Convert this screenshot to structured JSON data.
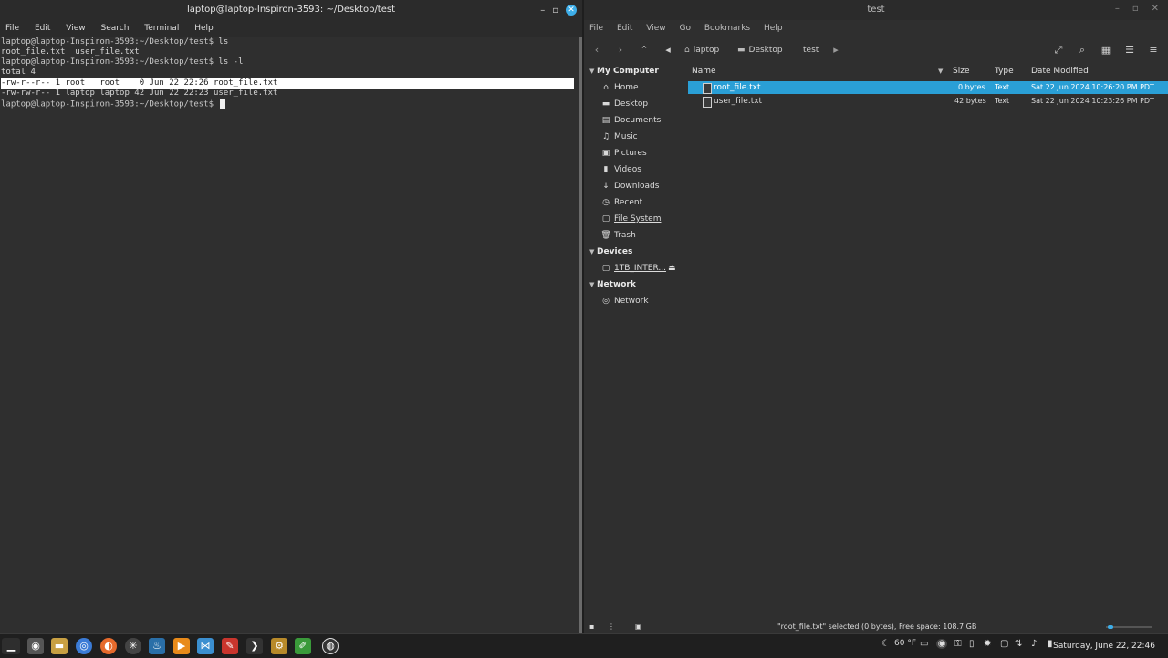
{
  "terminal": {
    "title": "laptop@laptop-Inspiron-3593: ~/Desktop/test",
    "menu": [
      "File",
      "Edit",
      "View",
      "Search",
      "Terminal",
      "Help"
    ],
    "lines": [
      {
        "prompt": "laptop@laptop-Inspiron-3593:~/Desktop/test$",
        "text": " ls"
      },
      {
        "prompt": "",
        "text": "root_file.txt  user_file.txt"
      },
      {
        "prompt": "laptop@laptop-Inspiron-3593:~/Desktop/test$",
        "text": " ls -l"
      },
      {
        "prompt": "",
        "text": "total 4"
      },
      {
        "prompt": "",
        "text": "-rw-r--r-- 1 root   root    0 Jun 22 22:26 root_file.txt"
      },
      {
        "prompt": "",
        "text": "-rw-rw-r-- 1 laptop laptop 42 Jun 22 22:23 user_file.txt"
      },
      {
        "prompt": "laptop@laptop-Inspiron-3593:~/Desktop/test$",
        "text": " "
      }
    ]
  },
  "filemanager": {
    "title": "test",
    "menu": [
      "File",
      "Edit",
      "View",
      "Go",
      "Bookmarks",
      "Help"
    ],
    "breadcrumb": [
      "laptop",
      "Desktop",
      "test"
    ],
    "sidebar": {
      "my_computer": {
        "label": "My Computer",
        "items": [
          "Home",
          "Desktop",
          "Documents",
          "Music",
          "Pictures",
          "Videos",
          "Downloads",
          "Recent",
          "File System",
          "Trash"
        ]
      },
      "devices": {
        "label": "Devices",
        "items": [
          "1TB_INTER..."
        ]
      },
      "network": {
        "label": "Network",
        "items": [
          "Network"
        ]
      }
    },
    "columns": [
      "Name",
      "Size",
      "Type",
      "Date Modified"
    ],
    "files": [
      {
        "name": "root_file.txt",
        "size": "0 bytes",
        "type": "Text",
        "modified": "Sat 22 Jun 2024 10:26:20 PM PDT",
        "selected": true
      },
      {
        "name": "user_file.txt",
        "size": "42 bytes",
        "type": "Text",
        "modified": "Sat 22 Jun 2024 10:23:26 PM PDT",
        "selected": false
      }
    ],
    "status": "\"root_file.txt\" selected (0 bytes), Free space: 108.7 GB"
  },
  "taskbar": {
    "temperature": "60 °F",
    "clock": "Saturday, June 22, 22:46"
  },
  "colors": {
    "selection": "#2a9fd6",
    "close_button": "#3daee9"
  }
}
